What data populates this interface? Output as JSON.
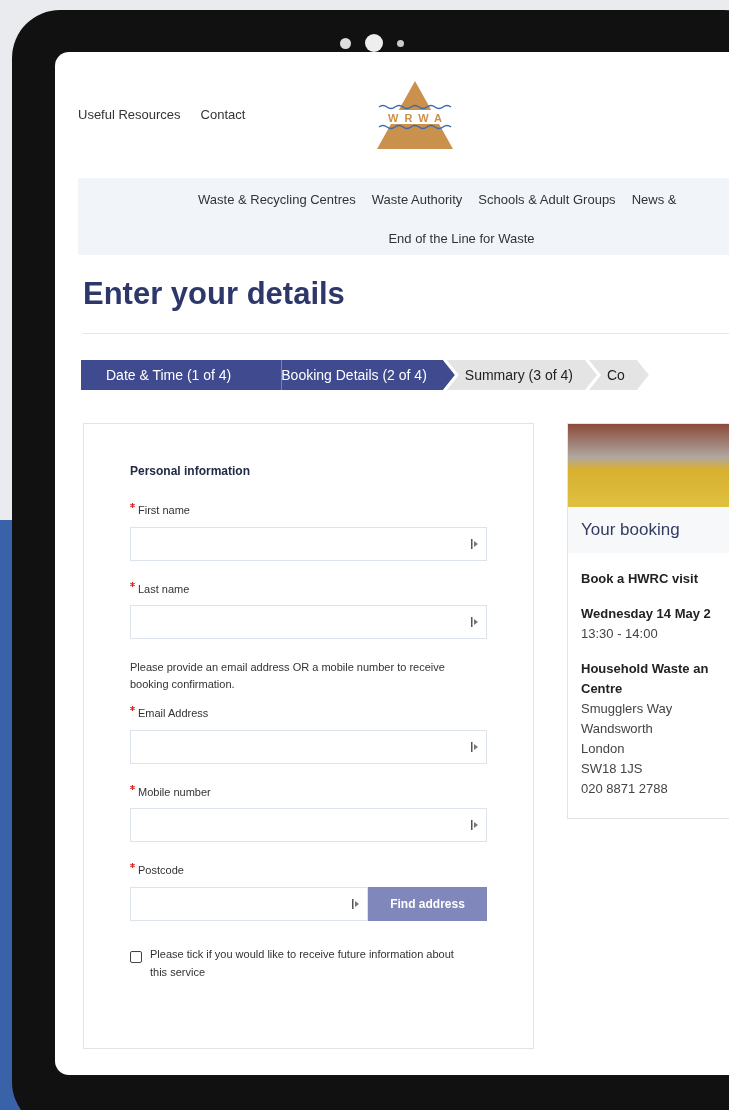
{
  "header": {
    "links": [
      "Useful Resources",
      "Contact"
    ],
    "logo_text": "WRWA"
  },
  "nav": {
    "row_1": [
      "Waste & Recycling Centres",
      "Waste Authority",
      "Schools & Adult Groups",
      "News &"
    ],
    "row_2": [
      "End of the Line for Waste"
    ]
  },
  "page_title": "Enter your details",
  "steps": [
    {
      "label": "Date & Time (1 of 4)",
      "completed": true,
      "selected": false
    },
    {
      "label": "Booking Details (2 of 4)",
      "completed": false,
      "selected": true
    },
    {
      "label": "Summary (3 of 4)",
      "completed": false,
      "selected": false
    },
    {
      "label": "Co",
      "completed": false,
      "selected": false
    }
  ],
  "form": {
    "heading": "Personal information",
    "items": [
      {
        "kind": "field",
        "label": "First name",
        "required": true
      },
      {
        "kind": "field",
        "label": "Last name",
        "required": true
      },
      {
        "kind": "note",
        "text": "Please provide an email address OR a mobile number to receive booking confirmation."
      },
      {
        "kind": "field",
        "label": "Email Address",
        "required": true
      },
      {
        "kind": "field",
        "label": "Mobile number",
        "required": true
      },
      {
        "kind": "postcode",
        "label": "Postcode",
        "required": true,
        "button": "Find address"
      }
    ],
    "checkbox": {
      "label": "Please tick if you would like to receive future information about this service",
      "checked": false
    }
  },
  "booking": {
    "title": "Your booking",
    "service": "Book a HWRC visit",
    "date": "Wednesday 14 May 2",
    "time": "13:30 - 14:00",
    "centre": [
      "Household Waste an",
      "Centre"
    ],
    "address": [
      "Smugglers Way",
      "Wandsworth",
      "London",
      "SW18 1JS",
      "020 8871 2788"
    ]
  }
}
